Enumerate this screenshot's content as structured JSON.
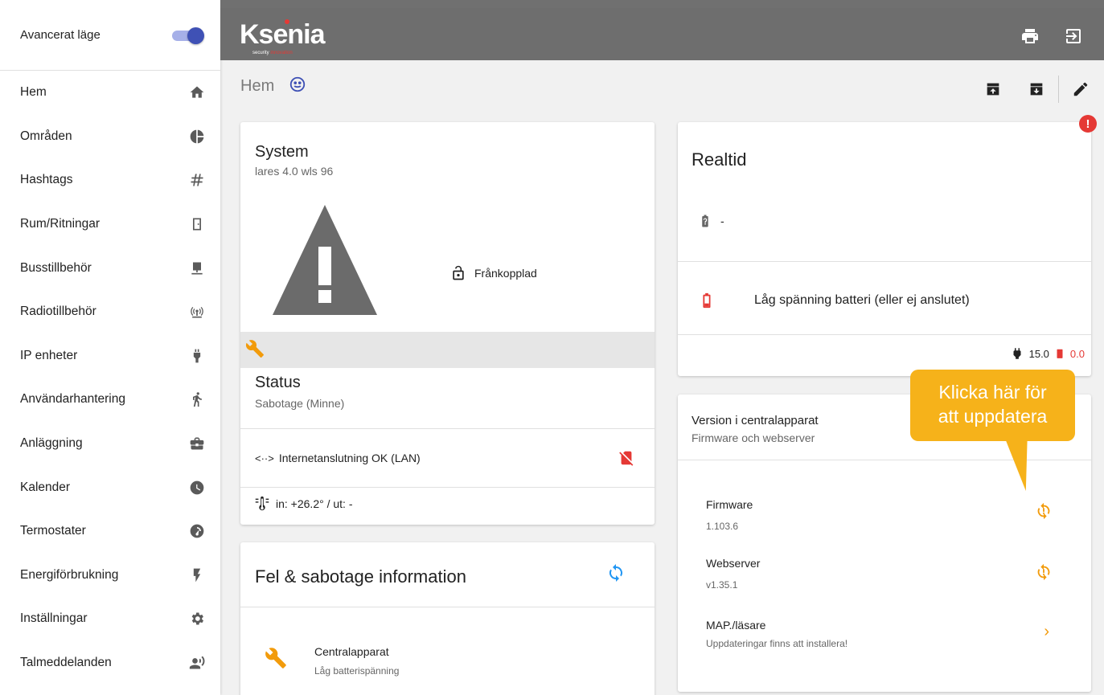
{
  "sidebar": {
    "advanced_mode_label": "Avancerat läge",
    "advanced_mode_on": true,
    "items": [
      {
        "label": "Hem",
        "icon": "home-icon"
      },
      {
        "label": "Områden",
        "icon": "pie-chart-icon"
      },
      {
        "label": "Hashtags",
        "icon": "hashtag-icon"
      },
      {
        "label": "Rum/Ritningar",
        "icon": "door-icon"
      },
      {
        "label": "Busstillbehör",
        "icon": "monitor-icon"
      },
      {
        "label": "Radiotillbehör",
        "icon": "radio-tower-icon"
      },
      {
        "label": "IP enheter",
        "icon": "plug-icon"
      },
      {
        "label": "Användarhantering",
        "icon": "walking-person-icon"
      },
      {
        "label": "Anläggning",
        "icon": "briefcase-icon"
      },
      {
        "label": "Kalender",
        "icon": "clock-icon"
      },
      {
        "label": "Termostater",
        "icon": "gauge-icon"
      },
      {
        "label": "Energiförbrukning",
        "icon": "lightning-icon"
      },
      {
        "label": "Inställningar",
        "icon": "gear-icon"
      },
      {
        "label": "Talmeddelanden",
        "icon": "speaking-person-icon"
      }
    ]
  },
  "header": {
    "logo_text": "Ksenia",
    "logo_tag_a": "security",
    "logo_tag_b": "innovation"
  },
  "breadcrumb": {
    "title": "Hem"
  },
  "system": {
    "title": "System",
    "subtitle": "lares 4.0 wls 96",
    "lock_status": "Frånkopplad",
    "status_title": "Status",
    "status_value": "Sabotage (Minne)",
    "network": "Internetanslutning OK (LAN)",
    "temperature": "in: +26.2° / ut: -"
  },
  "fault": {
    "title": "Fel & sabotage information",
    "item_title": "Centralapparat",
    "item_sub": "Låg batterispänning"
  },
  "realtime": {
    "title": "Realtid",
    "battery_value": "-",
    "low_battery": "Låg spänning batteri (eller ej anslutet)",
    "power_value": "15.0",
    "battery_volt": "0.0",
    "alert": "!"
  },
  "version": {
    "title": "Version i centralapparat",
    "subtitle": "Firmware och webserver",
    "rows": [
      {
        "title": "Firmware",
        "value": "1.103.6"
      },
      {
        "title": "Webserver",
        "value": "v1.35.1"
      },
      {
        "title": "MAP./läsare",
        "value": "Uppdateringar finns att installera!"
      }
    ]
  },
  "callout": {
    "line1": "Klicka här för",
    "line2": "att uppdatera"
  },
  "colors": {
    "accent": "#3f51b5",
    "warning": "#f29b0b",
    "error": "#e53935",
    "header": "#6e6e6e",
    "callout": "#f6b21a"
  }
}
